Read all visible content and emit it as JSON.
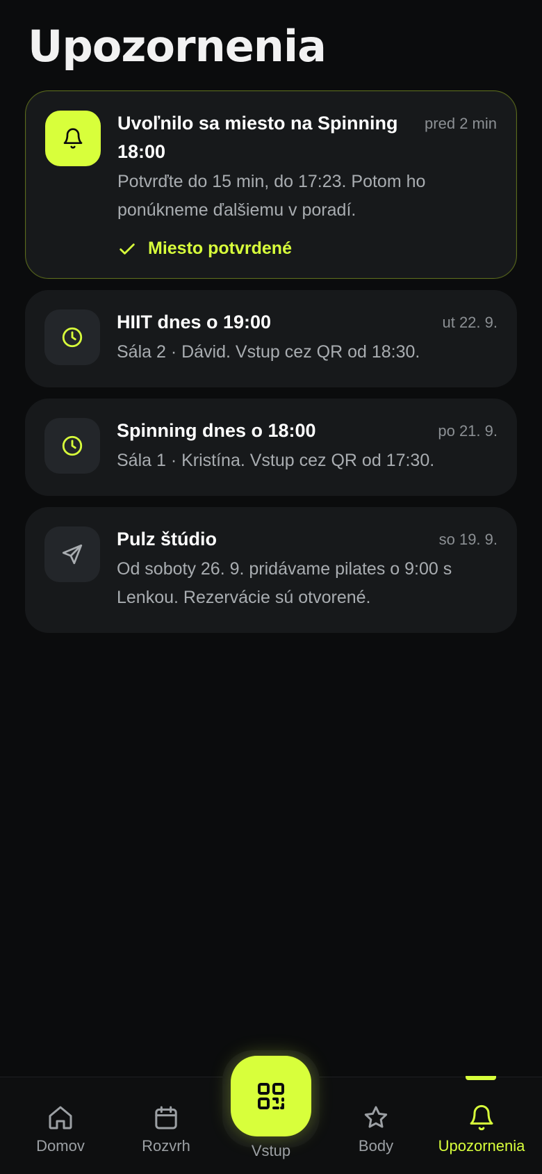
{
  "page": {
    "title": "Upozornenia"
  },
  "notifications": [
    {
      "icon": "bell-icon",
      "title": "Uvoľnilo sa miesto na Spinning 18:00",
      "time": "pred 2 min",
      "body": "Potvrďte do 15 min, do 17:23. Potom ho ponúkneme ďalšiemu v poradí.",
      "status": "Miesto potvrdené"
    },
    {
      "icon": "clock-icon",
      "title": "HIIT dnes o 19:00",
      "time": "ut 22. 9.",
      "body": "Sála 2 · Dávid. Vstup cez QR od 18:30."
    },
    {
      "icon": "clock-icon",
      "title": "Spinning dnes o 18:00",
      "time": "po 21. 9.",
      "body": "Sála 1 · Kristína. Vstup cez QR od 17:30."
    },
    {
      "icon": "send-icon",
      "title": "Pulz štúdio",
      "time": "so 19. 9.",
      "body": "Od soboty 26. 9. pridávame pilates o 9:00 s Lenkou. Rezervácie sú otvorené."
    }
  ],
  "nav": {
    "home": "Domov",
    "schedule": "Rozvrh",
    "entry": "Vstup",
    "points": "Body",
    "notifications": "Upozornenia"
  },
  "colors": {
    "accent": "#d8ff3b",
    "background": "#0b0c0d",
    "card": "#17191b"
  }
}
